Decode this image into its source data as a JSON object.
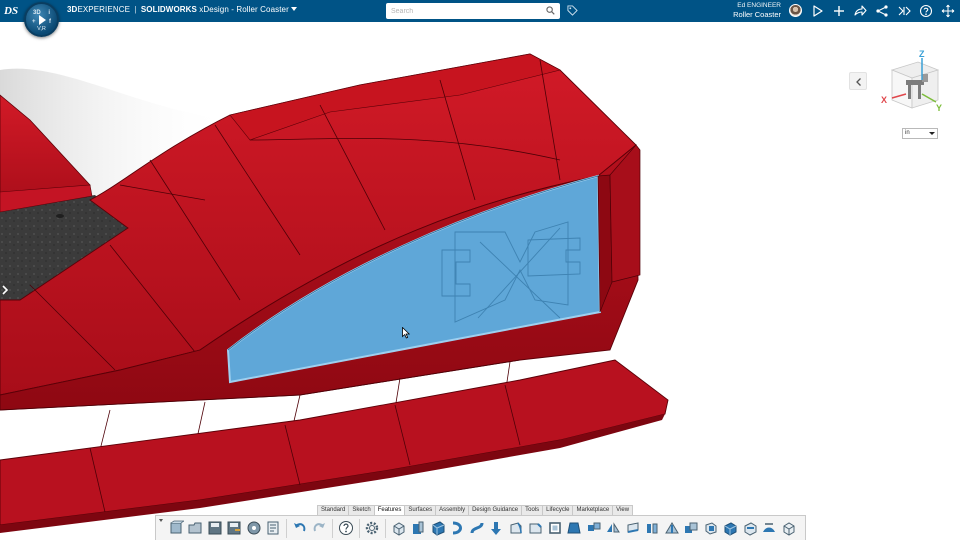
{
  "topbar": {
    "brand_3d": "3D",
    "brand_experience": "EXPERIENCE",
    "brand_sep": "|",
    "brand_product": "SOLIDWORKS",
    "app_name": "xDesign",
    "title_dash": "-",
    "document_name": "Roller Coaster",
    "compass_version": "V,R",
    "compass_quadrant_labels": [
      "3D",
      "i",
      "f",
      "+"
    ],
    "search_placeholder": "Search",
    "user_name": "Ed ENGINEER",
    "collab_space": "Roller Coaster"
  },
  "icons": {
    "ds_logo": "DS",
    "topbar": [
      "search-icon",
      "tag-icon",
      "share-play-icon",
      "add-icon",
      "share-icon",
      "network-icon",
      "apps-icon",
      "help-icon",
      "compass-arrows-icon"
    ],
    "actionbar": [
      "new-part-icon",
      "open-icon",
      "save-icon",
      "save-as-icon",
      "save-with-options-icon",
      "revision-icon",
      "undo-icon",
      "redo-icon",
      "help-button-icon",
      "settings-icon",
      "extrude-icon",
      "extrude-cut-icon",
      "revolve-icon",
      "sweep-icon",
      "loft-icon",
      "hole-icon",
      "fillet-icon",
      "chamfer-icon",
      "shell-icon",
      "draft-icon",
      "pattern-icon",
      "mirror-icon",
      "thicken-icon",
      "split-icon",
      "rib-icon",
      "combine-icon",
      "intersect-icon",
      "move-body-icon",
      "wrap-icon",
      "emboss-icon",
      "fill-pattern-icon"
    ]
  },
  "tabs": [
    "Standard",
    "Sketch",
    "Features",
    "Surfaces",
    "Assembly",
    "Design Guidance",
    "Tools",
    "Lifecycle",
    "Marketplace",
    "View"
  ],
  "active_tab": "Features",
  "viewcube": {
    "axis_x": "X",
    "axis_y": "Y",
    "axis_z": "Z",
    "axis_colors": {
      "x": "#e0474c",
      "y": "#7cbd3a",
      "z": "#3aa0d6"
    }
  },
  "units": {
    "selected": "in"
  },
  "colors": {
    "topbar": "#005386",
    "body_red": "#b8111f",
    "selected_face": "#5fa7d8",
    "floor": "#3a3a3a"
  }
}
